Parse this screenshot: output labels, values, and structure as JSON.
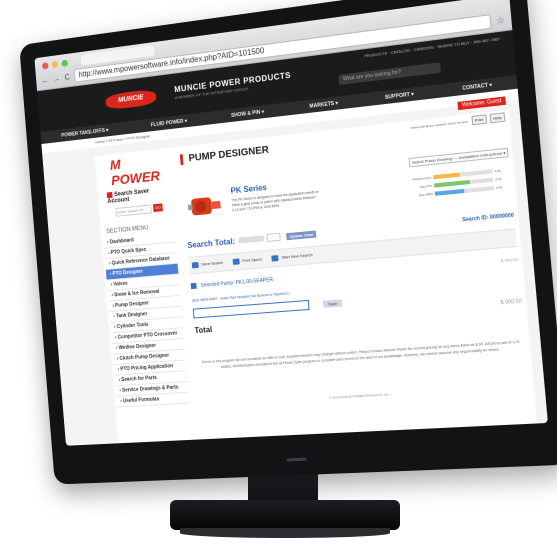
{
  "browser": {
    "url": "http://www.mpowersoftware.info/index.php?AID=101500",
    "nav_back": "←",
    "nav_forward": "→",
    "nav_reload": "C",
    "star": "☆"
  },
  "header": {
    "logo": "MUNCIE",
    "brand": "MUNCIE POWER PRODUCTS",
    "brand_sub": "A MEMBER OF THE INTERPUMP GROUP",
    "utility": "PRODUCTS · CATALOG · CAREERS · WHERE TO BUY · 800-367-7867",
    "search_placeholder": "What are you looking for?",
    "nav": [
      "POWER TAKE-OFFS ▾",
      "FLUID POWER ▾",
      "SHOW & PIN ▾",
      "MARKETS ▾",
      "SUPPORT ▾",
      "CONTACT ▾"
    ],
    "breadcrumb": "Home » M Power » PTO Designer",
    "welcome": "Welcome: Guest"
  },
  "sidebar": {
    "logo": "M POWER",
    "save_account": "Search Saver Account",
    "search_id_placeholder": "Enter Search ID",
    "go": "GO",
    "section_menu": "SECTION MENU",
    "items": [
      "› Dashboard",
      "› PTO Quick Spec",
      "› Quick Reference Database",
      "› PTO Designer",
      "› Valves",
      "› Snow & Ice Removal",
      "› Pump Designer",
      "› Tank Designer",
      "› Cylinder Tools",
      "› Competitor PTO Crossover",
      "› Wetline Designer",
      "› Clutch Pump Designer",
      "› PTO Pricing Application",
      "› Search for Parts",
      "› Service Drawings & Parts",
      "› Useful Formulas"
    ],
    "active_index": 3
  },
  "main": {
    "title": "PUMP DESIGNER",
    "fields_note": "Fields with ■ are required. Hover for help.",
    "print_btn": "Print",
    "help_btn": "Help",
    "select_label": "Select Pump Drawing — Installation Instructions ▾",
    "product_title": "PK Series",
    "product_desc": "The PK Series is designed to meet the application needs of either a gear pump or piston with displacements between 0.12 and 7.5 GPM at 1000 RPM.",
    "bars": [
      {
        "label": "Displacement",
        "value": "0.00",
        "fill": 0.45,
        "color": "#f4b74a"
      },
      {
        "label": "Max PSI",
        "value": "0.00",
        "fill": 0.6,
        "color": "#7cc56b"
      },
      {
        "label": "Max RPM",
        "value": "0.00",
        "fill": 0.5,
        "color": "#5aa7e0"
      }
    ],
    "search_total_label": "Search Total:",
    "update_btn": "Update Total",
    "search_id": "Search ID: 00000000",
    "actions": [
      "Save Search",
      "Print Specs",
      "Start New Search"
    ],
    "selected_pump": "Selected Pump: PK1-00-SEAPER",
    "selected_price": "$ 000.00",
    "add_part": "ADD NEW PART : Enter Part Number( No Spaces or Hyphens )",
    "save_btn": "Save",
    "total_label": "Total",
    "total_price": "$ 000.00",
    "disclaimer": "Prices in this program do not constitute an offer to sell. Supplier/vendors may change without notice. Please contact Muncie Power for current pricing on any items listed as $.00. All prices are in U.S. dollars. All information included in the M Power Spec program is complete and correct to the best of our knowledge. However, we cannot assume any responsibility for errors.",
    "copyright": "© 2014 MUNCIE POWER PRODUCTS, INC."
  },
  "colors": {
    "brand_red": "#d9271d",
    "link_blue": "#2b5fb8",
    "active_blue": "#4f7fd6"
  }
}
